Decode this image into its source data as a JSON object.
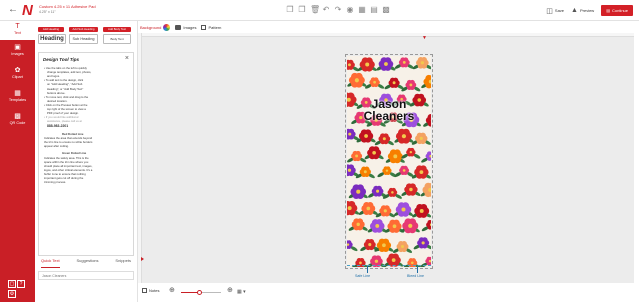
{
  "header": {
    "back_icon": "arrow-left-icon",
    "brand_logo": "N",
    "doc_title": "Custom 4.25 x 11 Adhesive Pad",
    "doc_size": "4.25\" x 11\"",
    "tools": [
      "copy-icon",
      "copy-alt-icon",
      "trash-icon",
      "undo-icon",
      "redo-icon",
      "layers-icon",
      "grid-icon",
      "align-icon",
      "lock-icon"
    ],
    "save_label": "Save",
    "preview_label": "Preview",
    "continue_label": "Continue",
    "accent_color": "#d32027"
  },
  "rail": {
    "items": [
      {
        "label": "Text",
        "icon": "text-icon"
      },
      {
        "label": "Images",
        "icon": "image-icon"
      },
      {
        "label": "Clipart",
        "icon": "clipart-icon"
      },
      {
        "label": "Templates",
        "icon": "templates-icon"
      },
      {
        "label": "QR Code",
        "icon": "qr-code-icon"
      }
    ],
    "bottom_icons": [
      "fullscreen-icon",
      "help-icon",
      "settings-icon"
    ]
  },
  "text_panel": {
    "badges": [
      "Add Heading",
      "Add Sub Heading",
      "Add Body Text"
    ],
    "style_buttons": [
      "Heading",
      "Sub Heading",
      "Body Text"
    ],
    "tips": {
      "title": "Design Tool Tips",
      "lines": [
        {
          "text": "Use the tabs on the left to quickly",
          "type": "bullet"
        },
        {
          "text": "change templates, add text, photos,",
          "type": "cont"
        },
        {
          "text": "and logos.",
          "type": "cont"
        },
        {
          "text": "To add text to the design, click",
          "type": "bullet"
        },
        {
          "text": "on \"Add Heading\", \"Add Sub",
          "type": "cont"
        },
        {
          "text": "Heading\", or \"Add Body Text\"",
          "type": "cont"
        },
        {
          "text": "buttons above.",
          "type": "cont"
        },
        {
          "text": "To move text, click and drag to the",
          "type": "bullet"
        },
        {
          "text": "desired location.",
          "type": "cont"
        },
        {
          "text": "Click on the Preview button at the",
          "type": "bullet"
        },
        {
          "text": "top right of the screen to view a",
          "type": "cont"
        },
        {
          "text": "PDF proof of your design.",
          "type": "cont"
        },
        {
          "text": "If you would like additional",
          "type": "bullet-faded"
        },
        {
          "text": "assistance, please call us at",
          "type": "cont-faded"
        },
        {
          "text": "888-983-2201",
          "type": "strong"
        },
        {
          "text": "Red Dotted Line",
          "type": "head"
        },
        {
          "text": "Indicates the area that extends beyond",
          "type": "plain"
        },
        {
          "text": "the trim line to ensure no white borders",
          "type": "plain"
        },
        {
          "text": "appear after cutting.",
          "type": "plain"
        },
        {
          "text": "Green Dotted Line",
          "type": "head"
        },
        {
          "text": "Indicates the safety area. This is the",
          "type": "plain"
        },
        {
          "text": "space within the trim line where you",
          "type": "plain"
        },
        {
          "text": "should place all important text, images,",
          "type": "plain"
        },
        {
          "text": "logos, and other critical elements. It's a",
          "type": "plain"
        },
        {
          "text": "buffer zone to ensure that nothing",
          "type": "plain"
        },
        {
          "text": "important gets cut off during the",
          "type": "plain"
        },
        {
          "text": "trimming process.",
          "type": "plain"
        }
      ]
    },
    "tabs": [
      {
        "label": "Quick Text",
        "active": true
      },
      {
        "label": "Suggestions",
        "active": false
      },
      {
        "label": "Snippets",
        "active": false
      }
    ],
    "input_value": "Jason Cleaners"
  },
  "canvas_toolbar": {
    "background_label": "Background",
    "images_label": "Images",
    "pattern_label": "Pattern"
  },
  "canvas": {
    "design_text_line1": "Jason",
    "design_text_line2": "Cleaners",
    "safe_line_label": "Safe Line",
    "bleed_line_label": "Bleed Line"
  },
  "bottom_bar": {
    "notes_label": "Notes",
    "zoom_level": 0.45
  }
}
